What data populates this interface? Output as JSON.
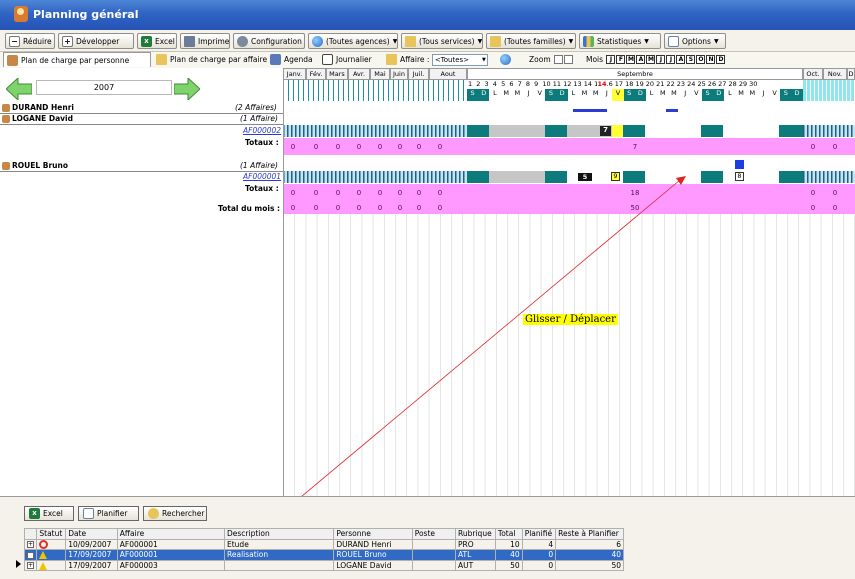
{
  "window": {
    "title": "Planning général"
  },
  "toolbar": {
    "reduce": "Réduire",
    "develop": "Développer",
    "excel": "Excel",
    "print": "Imprimer",
    "config": "Configuration",
    "agencies": "(Toutes agences)",
    "services": "(Tous services)",
    "families": "(Toutes familles)",
    "stats": "Statistiques",
    "options": "Options"
  },
  "tabs": {
    "by_person": "Plan de charge par personne",
    "by_affair": "Plan de charge par affaire",
    "agenda": "Agenda",
    "journal": "Journalier",
    "affaire_label": "Affaire :",
    "affaire_value": "<Toutes>",
    "zoom_label": "Zoom",
    "month_label": "Mois",
    "month_letters": [
      "J",
      "F",
      "M",
      "A",
      "M",
      "J",
      "J",
      "A",
      "S",
      "O",
      "N",
      "D"
    ]
  },
  "nav": {
    "year": "2007"
  },
  "months": {
    "jan": "Janv.",
    "feb": "Fév.",
    "mar": "Mars",
    "apr": "Avr.",
    "may": "Mai",
    "jun": "Juin",
    "jul": "Juil.",
    "aug": "Aout",
    "sep": "Septembre",
    "oct": "Oct.",
    "nov": "Nov.",
    "dec": "D"
  },
  "days": {
    "numbers": "1  2  3  4  5  6  7  8  9  10 11 12 13 14 15 16 17 18 19 20 21 22 23 24 25 26 27 28 29 30",
    "today": "14",
    "letters": [
      "S",
      "D",
      "L",
      "M",
      "M",
      "J",
      "V",
      "S",
      "D",
      "L",
      "M",
      "M",
      "J",
      "V",
      "S",
      "D",
      "L",
      "M",
      "M",
      "J",
      "V",
      "S",
      "D",
      "L",
      "M",
      "M",
      "J",
      "V",
      "S",
      "D"
    ]
  },
  "rows": {
    "durand": {
      "name": "DURAND Henri",
      "note": "(2 Affaires)"
    },
    "logane": {
      "name": "LOGANE David",
      "note": "(1 Affaire)",
      "affaire": "AF000002",
      "totals_label": "Totaux :",
      "totals_months": [
        "0",
        "0",
        "0",
        "0",
        "0",
        "0",
        "0",
        "0"
      ],
      "totals_sep": "7",
      "totals_after": [
        "0",
        "0"
      ],
      "cell_value": "7"
    },
    "rouel": {
      "name": "ROUEL Bruno",
      "note": "(1 Affaire)",
      "affaire": "AF000001",
      "totals_label": "Totaux :",
      "totals_months": [
        "0",
        "0",
        "0",
        "0",
        "0",
        "0",
        "0",
        "0"
      ],
      "totals_sep": "18",
      "totals_after": [
        "0",
        "0"
      ],
      "cell_a": "5",
      "cell_b": "9",
      "cell_c": "8"
    },
    "month_total": {
      "label": "Total du mois :",
      "values": [
        "0",
        "0",
        "0",
        "0",
        "0",
        "0",
        "0",
        "0"
      ],
      "sep": "50",
      "after": [
        "0",
        "0"
      ]
    }
  },
  "annotation": {
    "label": "Glisser / Déplacer"
  },
  "bottom": {
    "excel": "Excel",
    "planifier": "Planifier",
    "rechercher": "Rechercher",
    "columns": [
      "Statut",
      "Date",
      "Affaire",
      "Description",
      "Personne",
      "Poste",
      "Rubrique",
      "Total",
      "Planifié",
      "Reste à Planifier"
    ],
    "rows": [
      {
        "date": "10/09/2007",
        "affaire": "AF000001",
        "description": "Etude",
        "personne": "DURAND Henri",
        "poste": "",
        "rubrique": "PRO",
        "total": "10",
        "planifie": "4",
        "reste": "6"
      },
      {
        "date": "17/09/2007",
        "affaire": "AF000001",
        "description": "Realisation",
        "personne": "ROUEL Bruno",
        "poste": "",
        "rubrique": "ATL",
        "total": "40",
        "planifie": "0",
        "reste": "40"
      },
      {
        "date": "17/09/2007",
        "affaire": "AF000003",
        "description": "",
        "personne": "LOGANE David",
        "poste": "",
        "rubrique": "AUT",
        "total": "50",
        "planifie": "0",
        "reste": "50"
      }
    ]
  }
}
